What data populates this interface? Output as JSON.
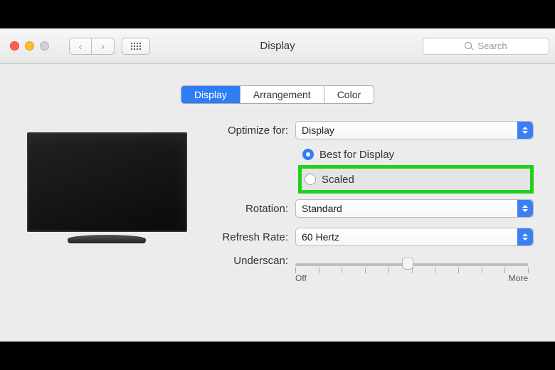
{
  "toolbar": {
    "title": "Display",
    "search_placeholder": "Search"
  },
  "tabs": [
    {
      "label": "Display",
      "active": true
    },
    {
      "label": "Arrangement",
      "active": false
    },
    {
      "label": "Color",
      "active": false
    }
  ],
  "fields": {
    "optimize_label": "Optimize for:",
    "optimize_value": "Display",
    "radio_best": "Best for Display",
    "radio_scaled": "Scaled",
    "radio_selected": "best",
    "rotation_label": "Rotation:",
    "rotation_value": "Standard",
    "refresh_label": "Refresh Rate:",
    "refresh_value": "60 Hertz",
    "underscan_label": "Underscan:",
    "underscan_min": "Off",
    "underscan_max": "More",
    "underscan_ticks": 10,
    "underscan_position_pct": 46
  }
}
